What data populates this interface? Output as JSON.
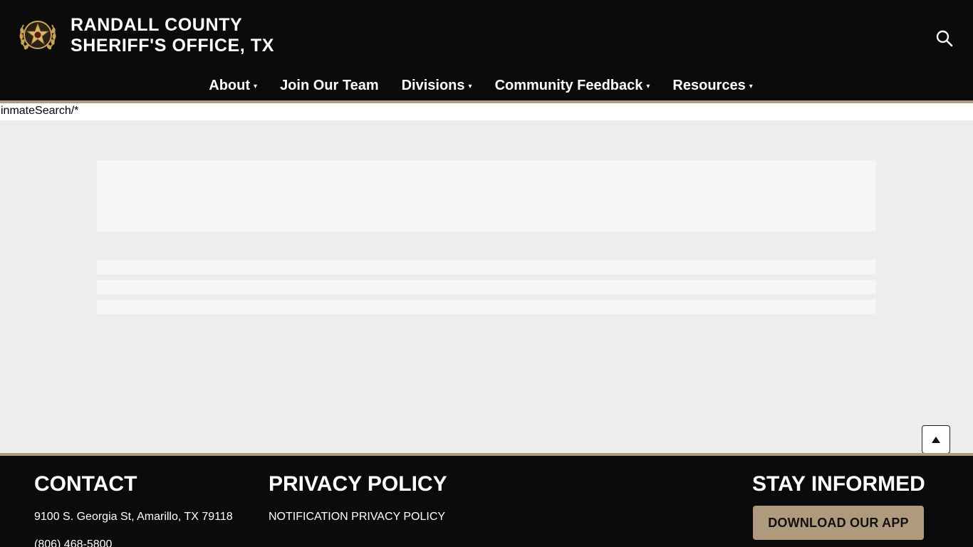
{
  "header": {
    "title_line1": "RANDALL COUNTY",
    "title_line2": "SHERIFF'S OFFICE, TX",
    "search_icon": "search-icon",
    "logo_icon": "sheriff-star-badge-icon"
  },
  "nav": {
    "items": [
      {
        "label": "About",
        "caret": "▾"
      },
      {
        "label": "Join Our Team",
        "caret": ""
      },
      {
        "label": "Divisions",
        "caret": "▾"
      },
      {
        "label": "Community Feedback",
        "caret": "▾"
      },
      {
        "label": "Resources",
        "caret": "▾"
      }
    ]
  },
  "content": {
    "raw_text": "inmateSearch/*"
  },
  "back_to_top_icon": "arrow-up-icon",
  "footer": {
    "contact": {
      "heading": "CONTACT",
      "address": "9100 S. Georgia St, Amarillo, TX 79118",
      "phone": "(806) 468-5800"
    },
    "privacy": {
      "heading": "PRIVACY POLICY",
      "link": "NOTIFICATION PRIVACY POLICY"
    },
    "stay_informed": {
      "heading": "STAY INFORMED",
      "button": "DOWNLOAD OUR APP"
    }
  },
  "colors": {
    "header_bg": "#0b0b0b",
    "accent": "#b09a7e",
    "page_bg": "#eeeded",
    "placeholder": "#f6f6f6"
  }
}
